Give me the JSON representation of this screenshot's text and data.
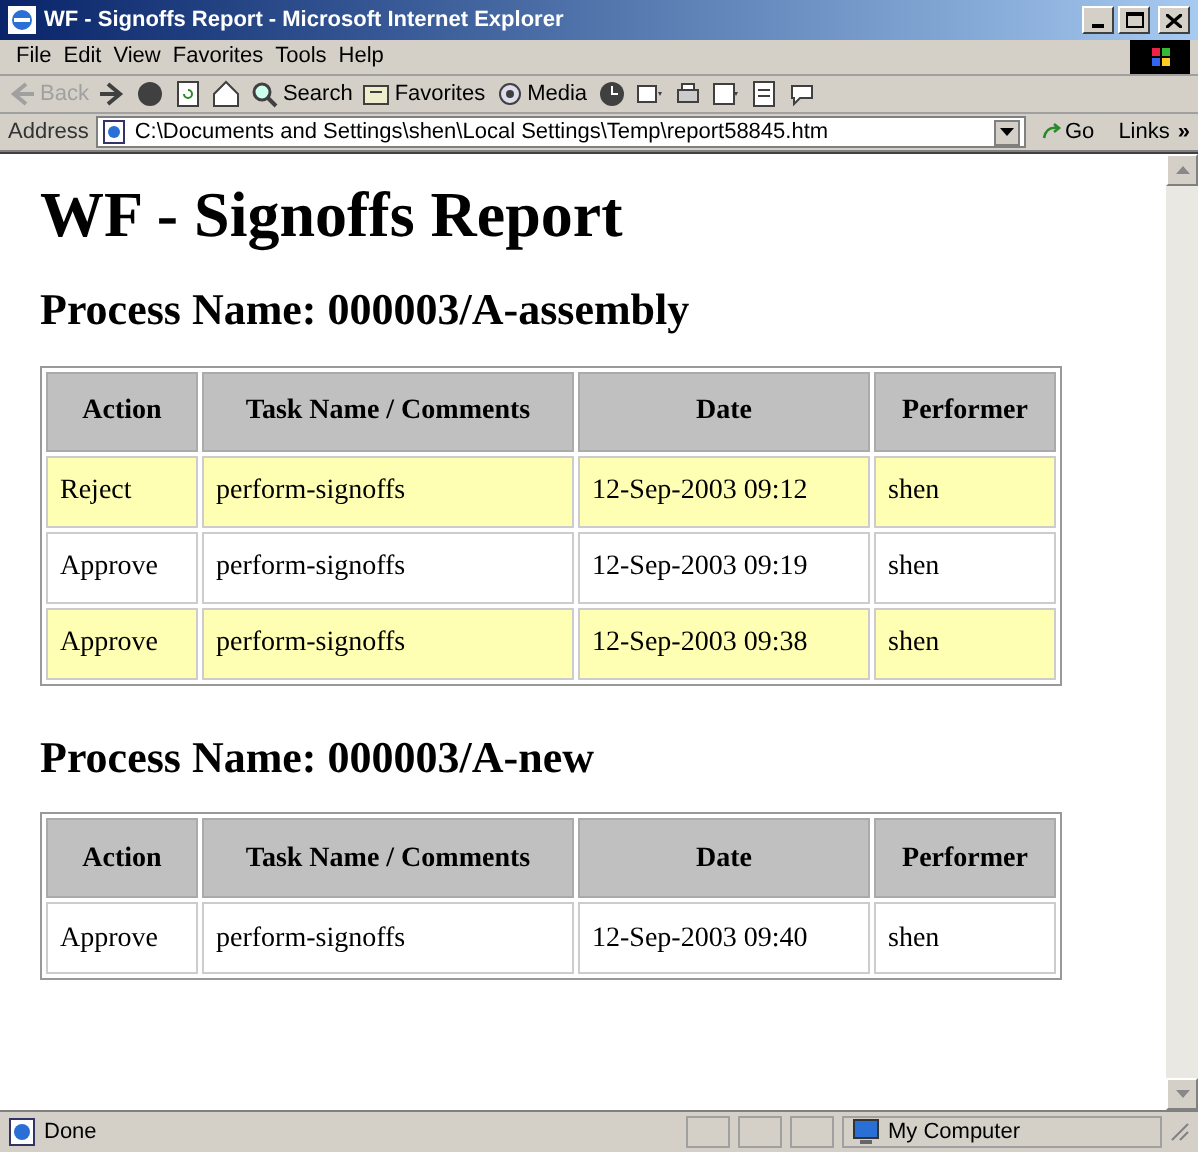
{
  "window": {
    "title": "WF - Signoffs Report - Microsoft Internet Explorer"
  },
  "menu": [
    "File",
    "Edit",
    "View",
    "Favorites",
    "Tools",
    "Help"
  ],
  "toolbar": [
    {
      "kind": "back",
      "label": "Back",
      "disabled": true
    },
    {
      "kind": "forward",
      "disabled": false
    },
    {
      "kind": "stop",
      "disabled": false
    },
    {
      "kind": "refresh",
      "disabled": false
    },
    {
      "kind": "home",
      "disabled": false
    },
    {
      "kind": "search",
      "label": "Search",
      "disabled": false
    },
    {
      "kind": "favorites",
      "label": "Favorites",
      "disabled": false
    },
    {
      "kind": "media",
      "label": "Media",
      "disabled": false
    },
    {
      "kind": "history",
      "disabled": false
    },
    {
      "kind": "mail",
      "disabled": false
    },
    {
      "kind": "print",
      "disabled": false
    },
    {
      "kind": "edit",
      "disabled": false
    },
    {
      "kind": "discuss",
      "disabled": false
    },
    {
      "kind": "messenger",
      "disabled": false
    }
  ],
  "address_bar": {
    "label": "Address",
    "value": "C:\\Documents and Settings\\shen\\Local Settings\\Temp\\report58845.htm",
    "go": "Go",
    "links": "Links",
    "more": "»"
  },
  "page": {
    "title": "WF - Signoffs Report",
    "sections": [
      {
        "heading": "Process Name: 000003/A-assembly",
        "columns": [
          "Action",
          "Task Name / Comments",
          "Date",
          "Performer"
        ],
        "rows": [
          {
            "highlighted": true,
            "cells": [
              "Reject",
              "perform-signoffs",
              "12-Sep-2003 09:12",
              "shen"
            ]
          },
          {
            "highlighted": false,
            "cells": [
              "Approve",
              "perform-signoffs",
              "12-Sep-2003 09:19",
              "shen"
            ]
          },
          {
            "highlighted": true,
            "cells": [
              "Approve",
              "perform-signoffs",
              "12-Sep-2003 09:38",
              "shen"
            ]
          }
        ]
      },
      {
        "heading": "Process Name: 000003/A-new",
        "columns": [
          "Action",
          "Task Name / Comments",
          "Date",
          "Performer"
        ],
        "rows": [
          {
            "highlighted": false,
            "cells": [
              "Approve",
              "perform-signoffs",
              "12-Sep-2003 09:40",
              "shen"
            ]
          }
        ]
      }
    ]
  },
  "status_bar": {
    "text": "Done",
    "zone": "My Computer"
  }
}
